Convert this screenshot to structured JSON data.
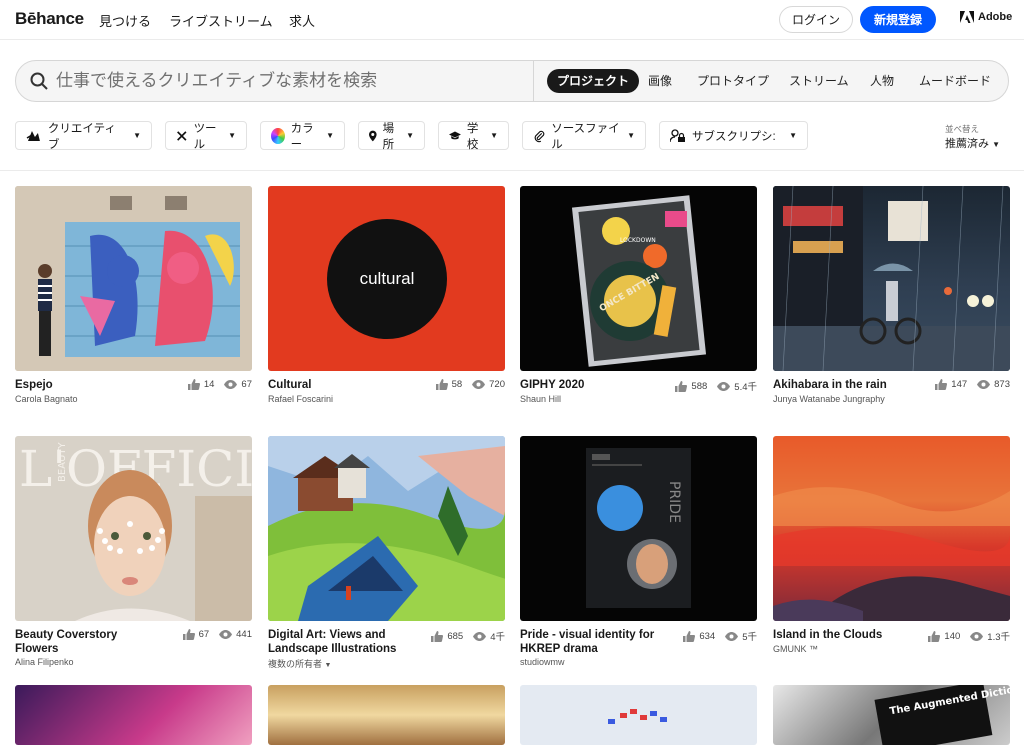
{
  "header": {
    "logo": "Bēhance",
    "nav": [
      "見つける",
      "ライブストリーム",
      "求人"
    ],
    "login": "ログイン",
    "signup": "新規登録",
    "adobe": "Adobe"
  },
  "search": {
    "placeholder": "仕事で使えるクリエイティブな素材を検索",
    "tabs": [
      "プロジェクト",
      "画像",
      "プロトタイプ",
      "ストリーム",
      "人物",
      "ムードボード"
    ]
  },
  "filters": [
    "クリエイティブ",
    "ツール",
    "カラー",
    "場所",
    "学校",
    "ソースファイル",
    "サブスクリプシ:"
  ],
  "sort": {
    "label": "並べ替え",
    "value": "推薦済み"
  },
  "projects": [
    {
      "title": "Espejo",
      "owner": "Carola Bagnato",
      "likes": "14",
      "views": "67"
    },
    {
      "title": "Cultural",
      "owner": "Rafael Foscarini",
      "likes": "58",
      "views": "720",
      "thumb_text": "cultural"
    },
    {
      "title": "GIPHY 2020",
      "owner": "Shaun Hill",
      "likes": "588",
      "views": "5.4千"
    },
    {
      "title": "Akihabara in the rain",
      "owner": "Junya Watanabe Jungraphy",
      "likes": "147",
      "views": "873"
    },
    {
      "title": "Beauty Coverstory Flowers",
      "owner": "Alina Filipenko",
      "likes": "67",
      "views": "441"
    },
    {
      "title": "Digital Art: Views and Landscape Illustrations",
      "owner": "複数の所有者",
      "likes": "685",
      "views": "4千"
    },
    {
      "title": "Pride - visual identity for HKREP drama",
      "owner": "studiowmw",
      "likes": "634",
      "views": "5千"
    },
    {
      "title": "Island in the Clouds",
      "owner": "GMUNK ™",
      "likes": "140",
      "views": "1.3千"
    }
  ],
  "thumb_texts": {
    "magazine": "L'OFFICIEL",
    "magazine_beauty": "BEAUTY",
    "giphy_lockdown": "LOCKDOWN",
    "giphy_main": "ONCE BITTEN",
    "pride": "PRIDE",
    "augmented": "The Augmented Dictionary of Typography"
  }
}
